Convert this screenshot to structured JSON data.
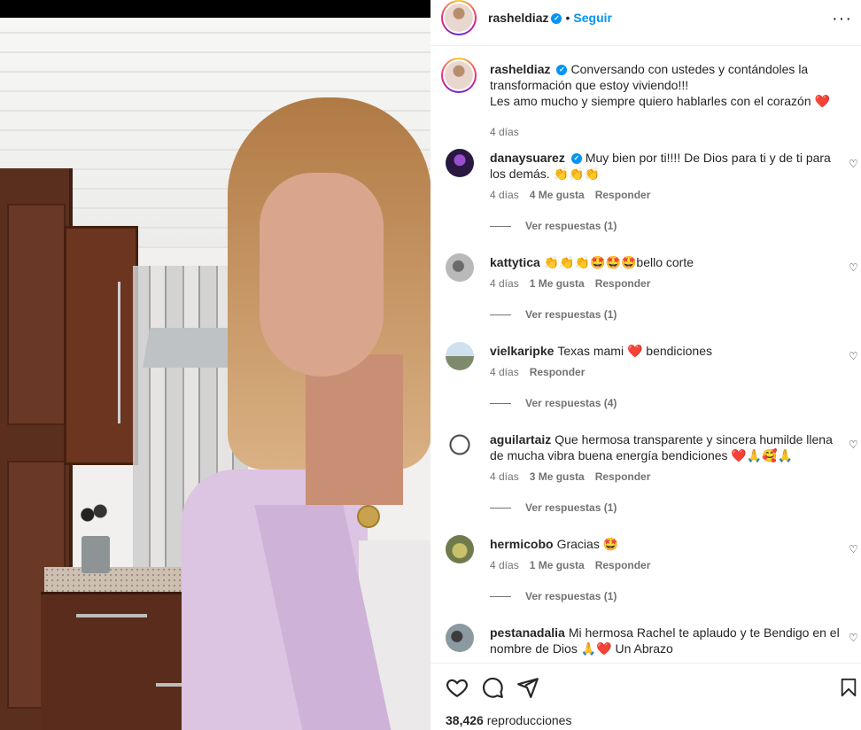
{
  "post": {
    "author": "rasheldiaz",
    "follow_label": "Seguir",
    "more_icon": "···",
    "caption_lines": [
      "Conversando con ustedes y contándoles la",
      "transformación que estoy viviendo!!!",
      "Les amo mucho y siempre quiero hablarles con el corazón"
    ],
    "caption_emoji": "❤️",
    "time": "4 días"
  },
  "comments": [
    {
      "user": "danaysuarez",
      "verified": true,
      "text": "Muy bien por ti!!!! De Dios para ti y de ti para los demás. 👏👏👏",
      "time": "4 días",
      "likes": "4 Me gusta",
      "reply_label": "Responder",
      "replies": "Ver respuestas (1)"
    },
    {
      "user": "kattytica",
      "verified": false,
      "text": "👏👏👏🤩🤩🤩bello corte",
      "time": "4 días",
      "likes": "1 Me gusta",
      "reply_label": "Responder",
      "replies": "Ver respuestas (1)"
    },
    {
      "user": "vielkaripke",
      "verified": false,
      "text": "Texas mami ❤️ bendiciones",
      "time": "4 días",
      "likes": "",
      "reply_label": "Responder",
      "replies": "Ver respuestas (4)"
    },
    {
      "user": "aguilartaiz",
      "verified": false,
      "text": "Que hermosa transparente y sincera humilde llena de mucha vibra buena energía bendiciones ❤️🙏🥰🙏",
      "time": "4 días",
      "likes": "3 Me gusta",
      "reply_label": "Responder",
      "replies": "Ver respuestas (1)"
    },
    {
      "user": "hermicobo",
      "verified": false,
      "text": "Gracias 🤩",
      "time": "4 días",
      "likes": "1 Me gusta",
      "reply_label": "Responder",
      "replies": "Ver respuestas (1)"
    },
    {
      "user": "pestanadalia",
      "verified": false,
      "text": "Mi hermosa Rachel te aplaudo y te Bendigo en el nombre de Dios 🙏❤️ Un Abrazo",
      "time": "",
      "likes": "",
      "reply_label": "",
      "replies": ""
    }
  ],
  "actions": {
    "like_icon": "heart-icon",
    "comment_icon": "comment-icon",
    "share_icon": "share-icon",
    "save_icon": "bookmark-icon"
  },
  "stats": {
    "views_count": "38,426",
    "views_label": "reproducciones"
  },
  "colors": {
    "accent_blue": "#0095f6",
    "text": "#262626",
    "secondary": "#737373",
    "heart_red": "#ed4956"
  }
}
